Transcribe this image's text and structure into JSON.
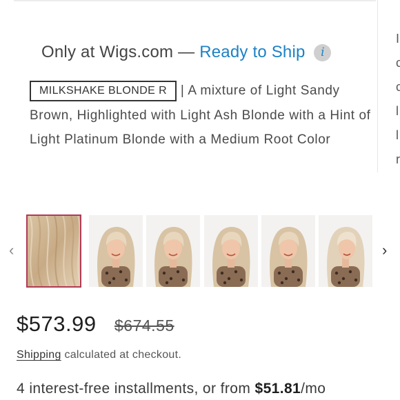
{
  "availability": {
    "exclusive_text": "Only at Wigs.com",
    "separator": "—",
    "status_text": "Ready to Ship",
    "info_icon": "info-icon",
    "info_glyph": "i",
    "status_color": "#1c82c6"
  },
  "color": {
    "name": "MILKSHAKE BLONDE R",
    "separator": "|",
    "description": "A mixture of Light Sandy Brown, Highlighted with Light Ash Blonde with a Hint of Light Platinum Blonde with a Medium Root Color"
  },
  "carousel": {
    "prev_icon": "chevron-left-icon",
    "next_icon": "chevron-right-icon",
    "prev_glyph": "‹",
    "next_glyph": "›",
    "thumbnails": [
      {
        "kind": "swatch",
        "selected": true
      },
      {
        "kind": "model",
        "selected": false
      },
      {
        "kind": "model",
        "selected": false
      },
      {
        "kind": "model",
        "selected": false
      },
      {
        "kind": "model",
        "selected": false
      },
      {
        "kind": "model",
        "selected": false
      }
    ],
    "selected_border_color": "#b03a55"
  },
  "pricing": {
    "price": "$573.99",
    "compare_at_price": "$674.55"
  },
  "shipping": {
    "link_label": "Shipping",
    "text": "calculated at checkout."
  },
  "installments": {
    "prefix": "4 interest-free installments, or from",
    "amount": "$51.81",
    "suffix": "/mo"
  },
  "right_column_peek": [
    "I",
    "c",
    "c",
    "l",
    "l",
    "r"
  ]
}
